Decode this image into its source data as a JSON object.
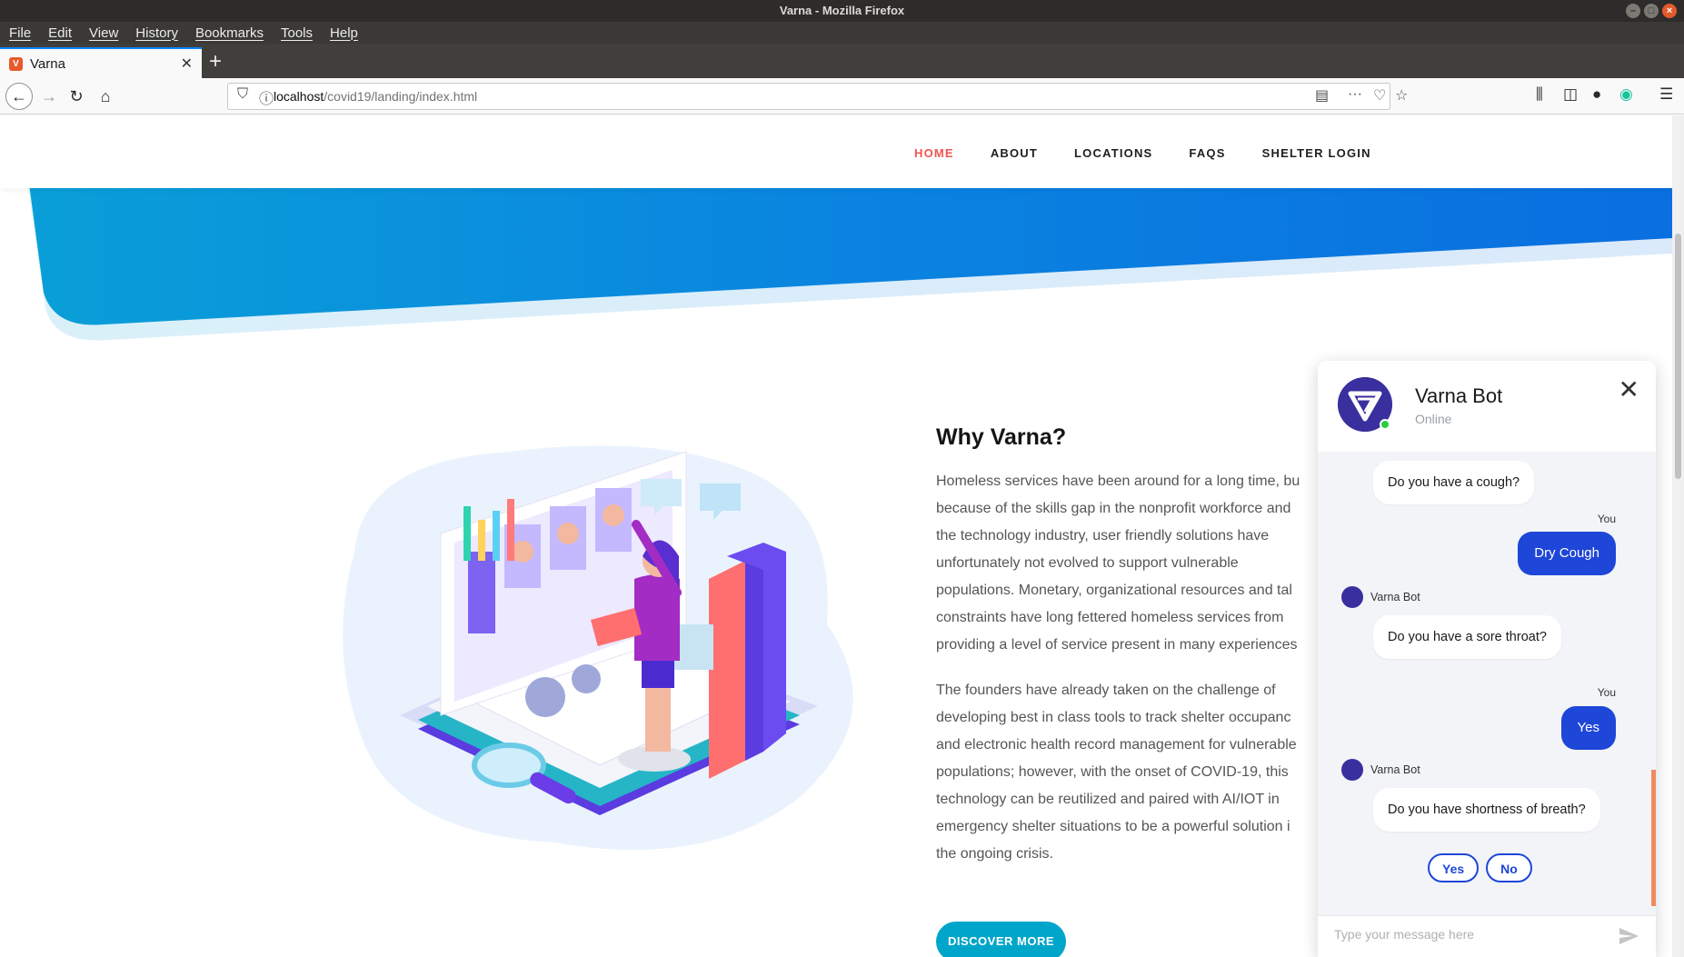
{
  "window": {
    "title": "Varna - Mozilla Firefox"
  },
  "menu": [
    "File",
    "Edit",
    "View",
    "History",
    "Bookmarks",
    "Tools",
    "Help"
  ],
  "tab": {
    "title": "Varna"
  },
  "url": {
    "host": "localhost",
    "path": "/covid19/landing/index.html"
  },
  "site_nav": {
    "home": "HOME",
    "about": "ABOUT",
    "locations": "LOCATIONS",
    "faqs": "FAQS",
    "shelter_login": "SHELTER LOGIN"
  },
  "section": {
    "heading": "Why Varna?",
    "para1": [
      "Homeless services have been around for a long time, bu",
      "because of the skills gap in the nonprofit workforce and",
      "the technology industry, user friendly solutions have",
      "unfortunately not evolved to support vulnerable",
      "populations. Monetary, organizational resources and tal",
      "constraints have long fettered homeless services from",
      "providing a level of service present in many experiences"
    ],
    "para2": [
      "The founders have already taken on the challenge of",
      "developing best in class tools to track shelter occupanc",
      "and electronic health record management for vulnerable",
      "populations; however, with the onset of COVID-19, this",
      "technology can be reutilized and paired with AI/IOT in",
      "emergency shelter situations to be a powerful solution i",
      "the ongoing crisis."
    ],
    "cta": "DISCOVER MORE"
  },
  "chat": {
    "bot_name": "Varna Bot",
    "status": "Online",
    "you_label": "You",
    "bot_label": "Varna Bot",
    "messages": {
      "q1": "Do you have a cough?",
      "a1": "Dry Cough",
      "q2": "Do you have a sore throat?",
      "a2": "Yes",
      "q3": "Do you have shortness of breath?"
    },
    "quick_replies": [
      "Yes",
      "No"
    ],
    "input_placeholder": "Type your message here"
  },
  "colors": {
    "accent_red": "#f0544f",
    "chat_blue": "#1e46d8",
    "cta_teal": "#00a6c9",
    "banner_blue": "#0a84e0"
  }
}
